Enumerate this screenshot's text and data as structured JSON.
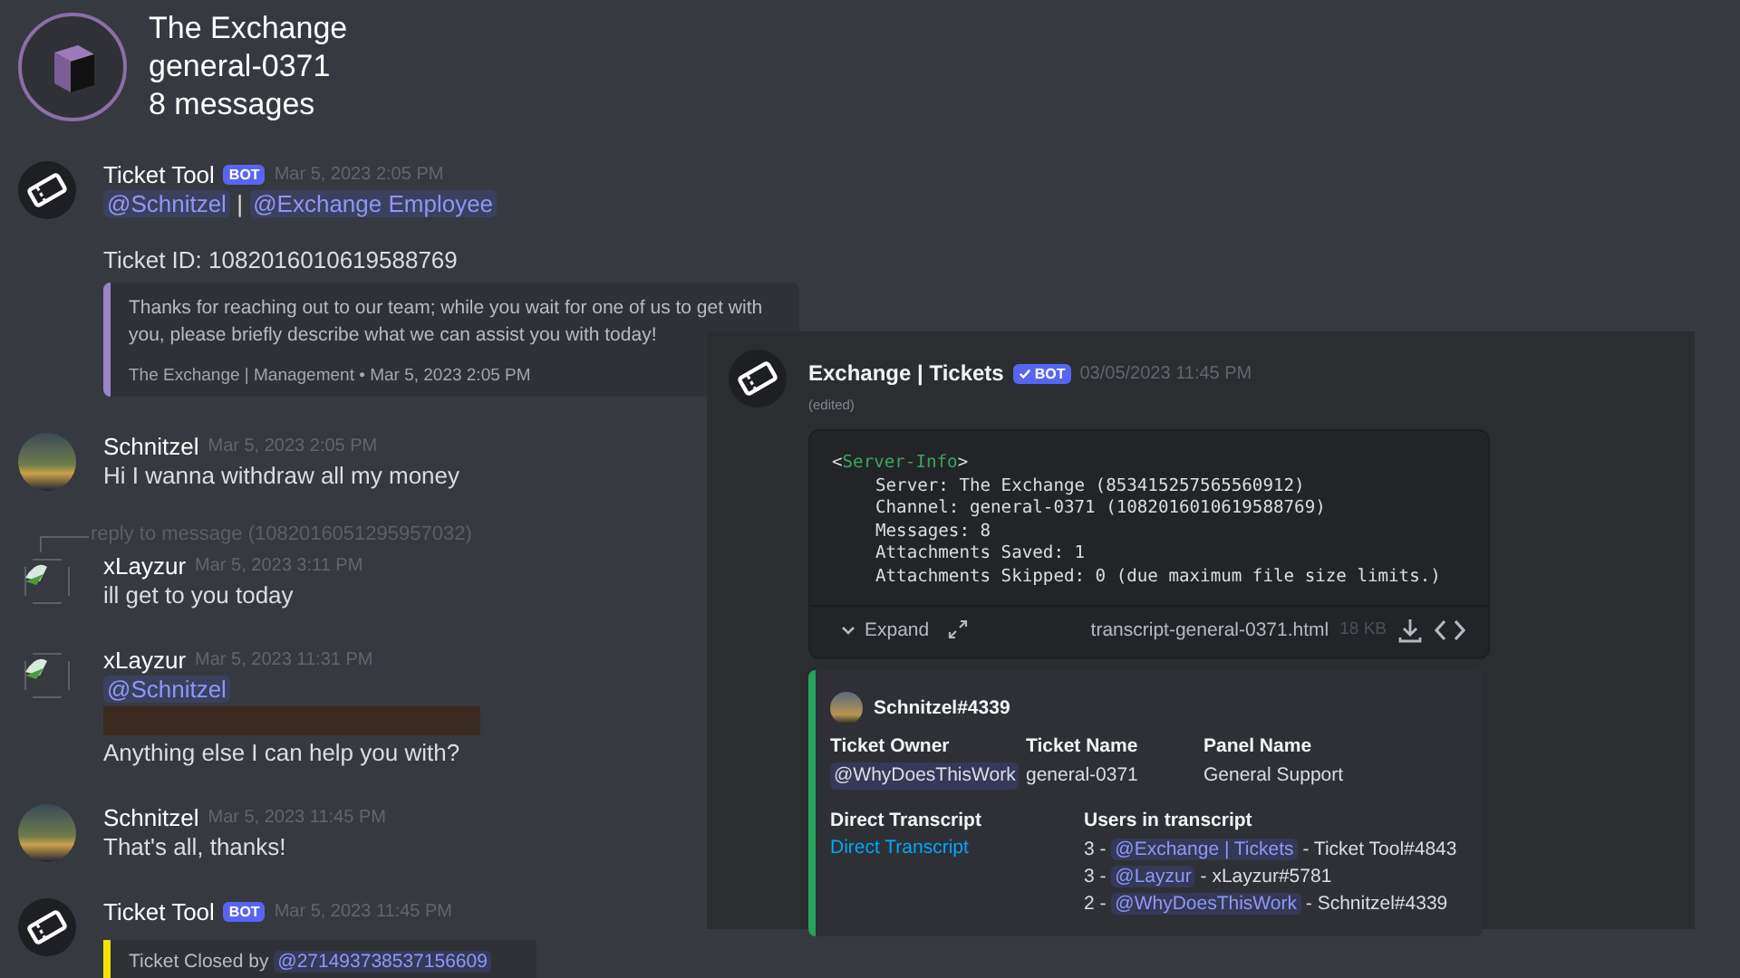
{
  "header": {
    "server": "The Exchange",
    "channel": "general-0371",
    "count": "8 messages"
  },
  "messages": [
    {
      "author": "Ticket Tool",
      "kind": "bot",
      "badge": "BOT",
      "time": "Mar 5, 2023 2:05 PM",
      "blocks": [
        {
          "kind": "mentions",
          "items": [
            "@Schnitzel",
            "@Exchange Employee"
          ],
          "separator": "|"
        },
        {
          "kind": "gap"
        },
        {
          "kind": "text",
          "text": "Ticket ID: 1082016010619588769"
        },
        {
          "kind": "embed",
          "color": "#9b84c9",
          "description": "Thanks for reaching out to our team; while you wait for one of us to get with you, please briefly describe what we can assist you with today!",
          "footer": "The Exchange | Management • Mar 5, 2023 2:05 PM"
        }
      ]
    },
    {
      "author": "Schnitzel",
      "kind": "member",
      "time": "Mar 5, 2023 2:05 PM",
      "blocks": [
        {
          "kind": "text",
          "text": "Hi I wanna withdraw all my money"
        }
      ]
    },
    {
      "author": "xLayzur",
      "kind": "guest",
      "time": "Mar 5, 2023 3:11 PM",
      "reply": "reply to message (1082016051295957032)",
      "blocks": [
        {
          "kind": "text",
          "text": "ill get to you today"
        }
      ]
    },
    {
      "author": "xLayzur",
      "kind": "guest",
      "time": "Mar 5, 2023 11:31 PM",
      "blocks": [
        {
          "kind": "mentions",
          "items": [
            "@Schnitzel"
          ]
        },
        {
          "kind": "image"
        },
        {
          "kind": "text",
          "text": "Anything else I can help you with?"
        }
      ]
    },
    {
      "author": "Schnitzel",
      "kind": "member",
      "time": "Mar 5, 2023 11:45 PM",
      "blocks": [
        {
          "kind": "text",
          "text": "That's all, thanks!"
        }
      ]
    },
    {
      "author": "Ticket Tool",
      "kind": "bot",
      "badge": "BOT",
      "time": "Mar 5, 2023 11:45 PM",
      "blocks": [
        {
          "kind": "closed",
          "color": "#f5e10a",
          "label": "Ticket Closed by",
          "mention": "@271493738537156609"
        }
      ]
    }
  ],
  "transcript_post": {
    "author": "Exchange | Tickets",
    "badge": "BOT",
    "verified": true,
    "time": "03/05/2023 11:45 PM",
    "edited": "(edited)",
    "attachment": {
      "tag_open": "<",
      "tag_name": "Server-Info",
      "tag_close": ">",
      "lines": [
        "Server: The Exchange (853415257565560912)",
        "Channel: general-0371 (1082016010619588769)",
        "Messages: 8",
        "Attachments Saved: 1",
        "Attachments Skipped: 0 (due maximum file size limits.)"
      ],
      "expand": "Expand",
      "filename": "transcript-general-0371.html",
      "size": "18 KB"
    },
    "embed": {
      "color": "#23a55a",
      "author": "Schnitzel#4339",
      "fields": [
        {
          "name": "Ticket Owner",
          "mention": "@WhyDoesThisWork"
        },
        {
          "name": "Ticket Name",
          "value": "general-0371"
        },
        {
          "name": "Panel Name",
          "value": "General Support"
        }
      ],
      "link_field": {
        "name": "Direct Transcript",
        "link": "Direct Transcript"
      },
      "users_field": {
        "name": "Users in transcript",
        "users": [
          {
            "prefix": "3 - ",
            "mention": "@Exchange | Tickets",
            "suffix": " - Ticket Tool#4843"
          },
          {
            "prefix": "3 - ",
            "mention": "@Layzur",
            "suffix": " - xLayzur#5781"
          },
          {
            "prefix": "2 - ",
            "mention": "@WhyDoesThisWork",
            "suffix": " - Schnitzel#4339"
          }
        ]
      }
    }
  }
}
